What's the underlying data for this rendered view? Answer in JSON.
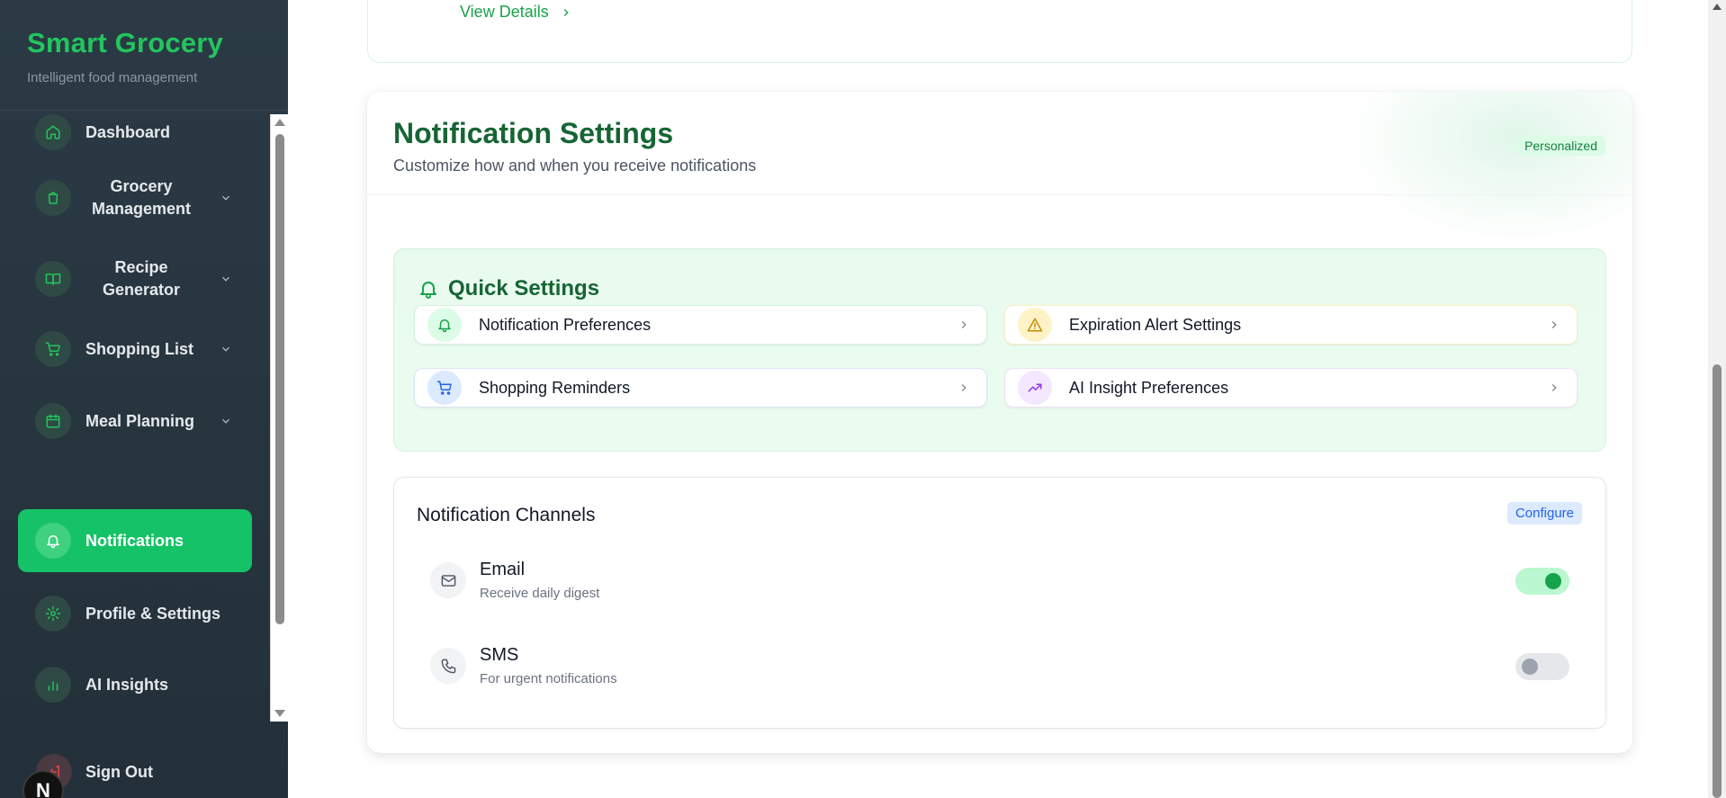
{
  "sidebar": {
    "brand_title": "Smart Grocery",
    "brand_subtitle": "Intelligent food management",
    "items": [
      {
        "label": "Dashboard",
        "icon": "home-icon"
      },
      {
        "label": "Grocery Management",
        "icon": "shopping-bag-icon",
        "expandable": true
      },
      {
        "label": "Recipe Generator",
        "icon": "book-icon",
        "expandable": true
      },
      {
        "label": "Shopping List",
        "icon": "cart-icon",
        "expandable": true
      },
      {
        "label": "Meal Planning",
        "icon": "calendar-icon",
        "expandable": true
      },
      {
        "label": "Notifications",
        "icon": "bell-icon",
        "active": true
      },
      {
        "label": "Profile & Settings",
        "icon": "gear-icon"
      },
      {
        "label": "AI Insights",
        "icon": "bar-chart-icon"
      }
    ],
    "sign_out": "Sign Out",
    "dev_badge": "N"
  },
  "top_card": {
    "link": "View Details"
  },
  "notification_settings": {
    "title": "Notification Settings",
    "subtitle": "Customize how and when you receive notifications",
    "badge": "Personalized"
  },
  "quick_settings": {
    "title": "Quick Settings",
    "items": [
      {
        "label": "Notification Preferences",
        "icon": "bell-icon",
        "accent": "#16a34a",
        "bg": "#dcfce7"
      },
      {
        "label": "Expiration Alert Settings",
        "icon": "warning-icon",
        "accent": "#ca8a04",
        "bg": "#fef3c7"
      },
      {
        "label": "Shopping Reminders",
        "icon": "cart-icon",
        "accent": "#2563eb",
        "bg": "#dbeafe"
      },
      {
        "label": "AI Insight Preferences",
        "icon": "trending-up-icon",
        "accent": "#9333ea",
        "bg": "#f3e8ff"
      }
    ]
  },
  "channels": {
    "title": "Notification Channels",
    "badge": "Configure",
    "items": [
      {
        "name": "Email",
        "description": "Receive daily digest",
        "icon": "mail-icon",
        "enabled": true
      },
      {
        "name": "SMS",
        "description": "For urgent notifications",
        "icon": "phone-icon",
        "enabled": false
      }
    ]
  },
  "colors": {
    "brand": "#22c55e",
    "active_nav": "#16c267",
    "heading": "#166534"
  }
}
